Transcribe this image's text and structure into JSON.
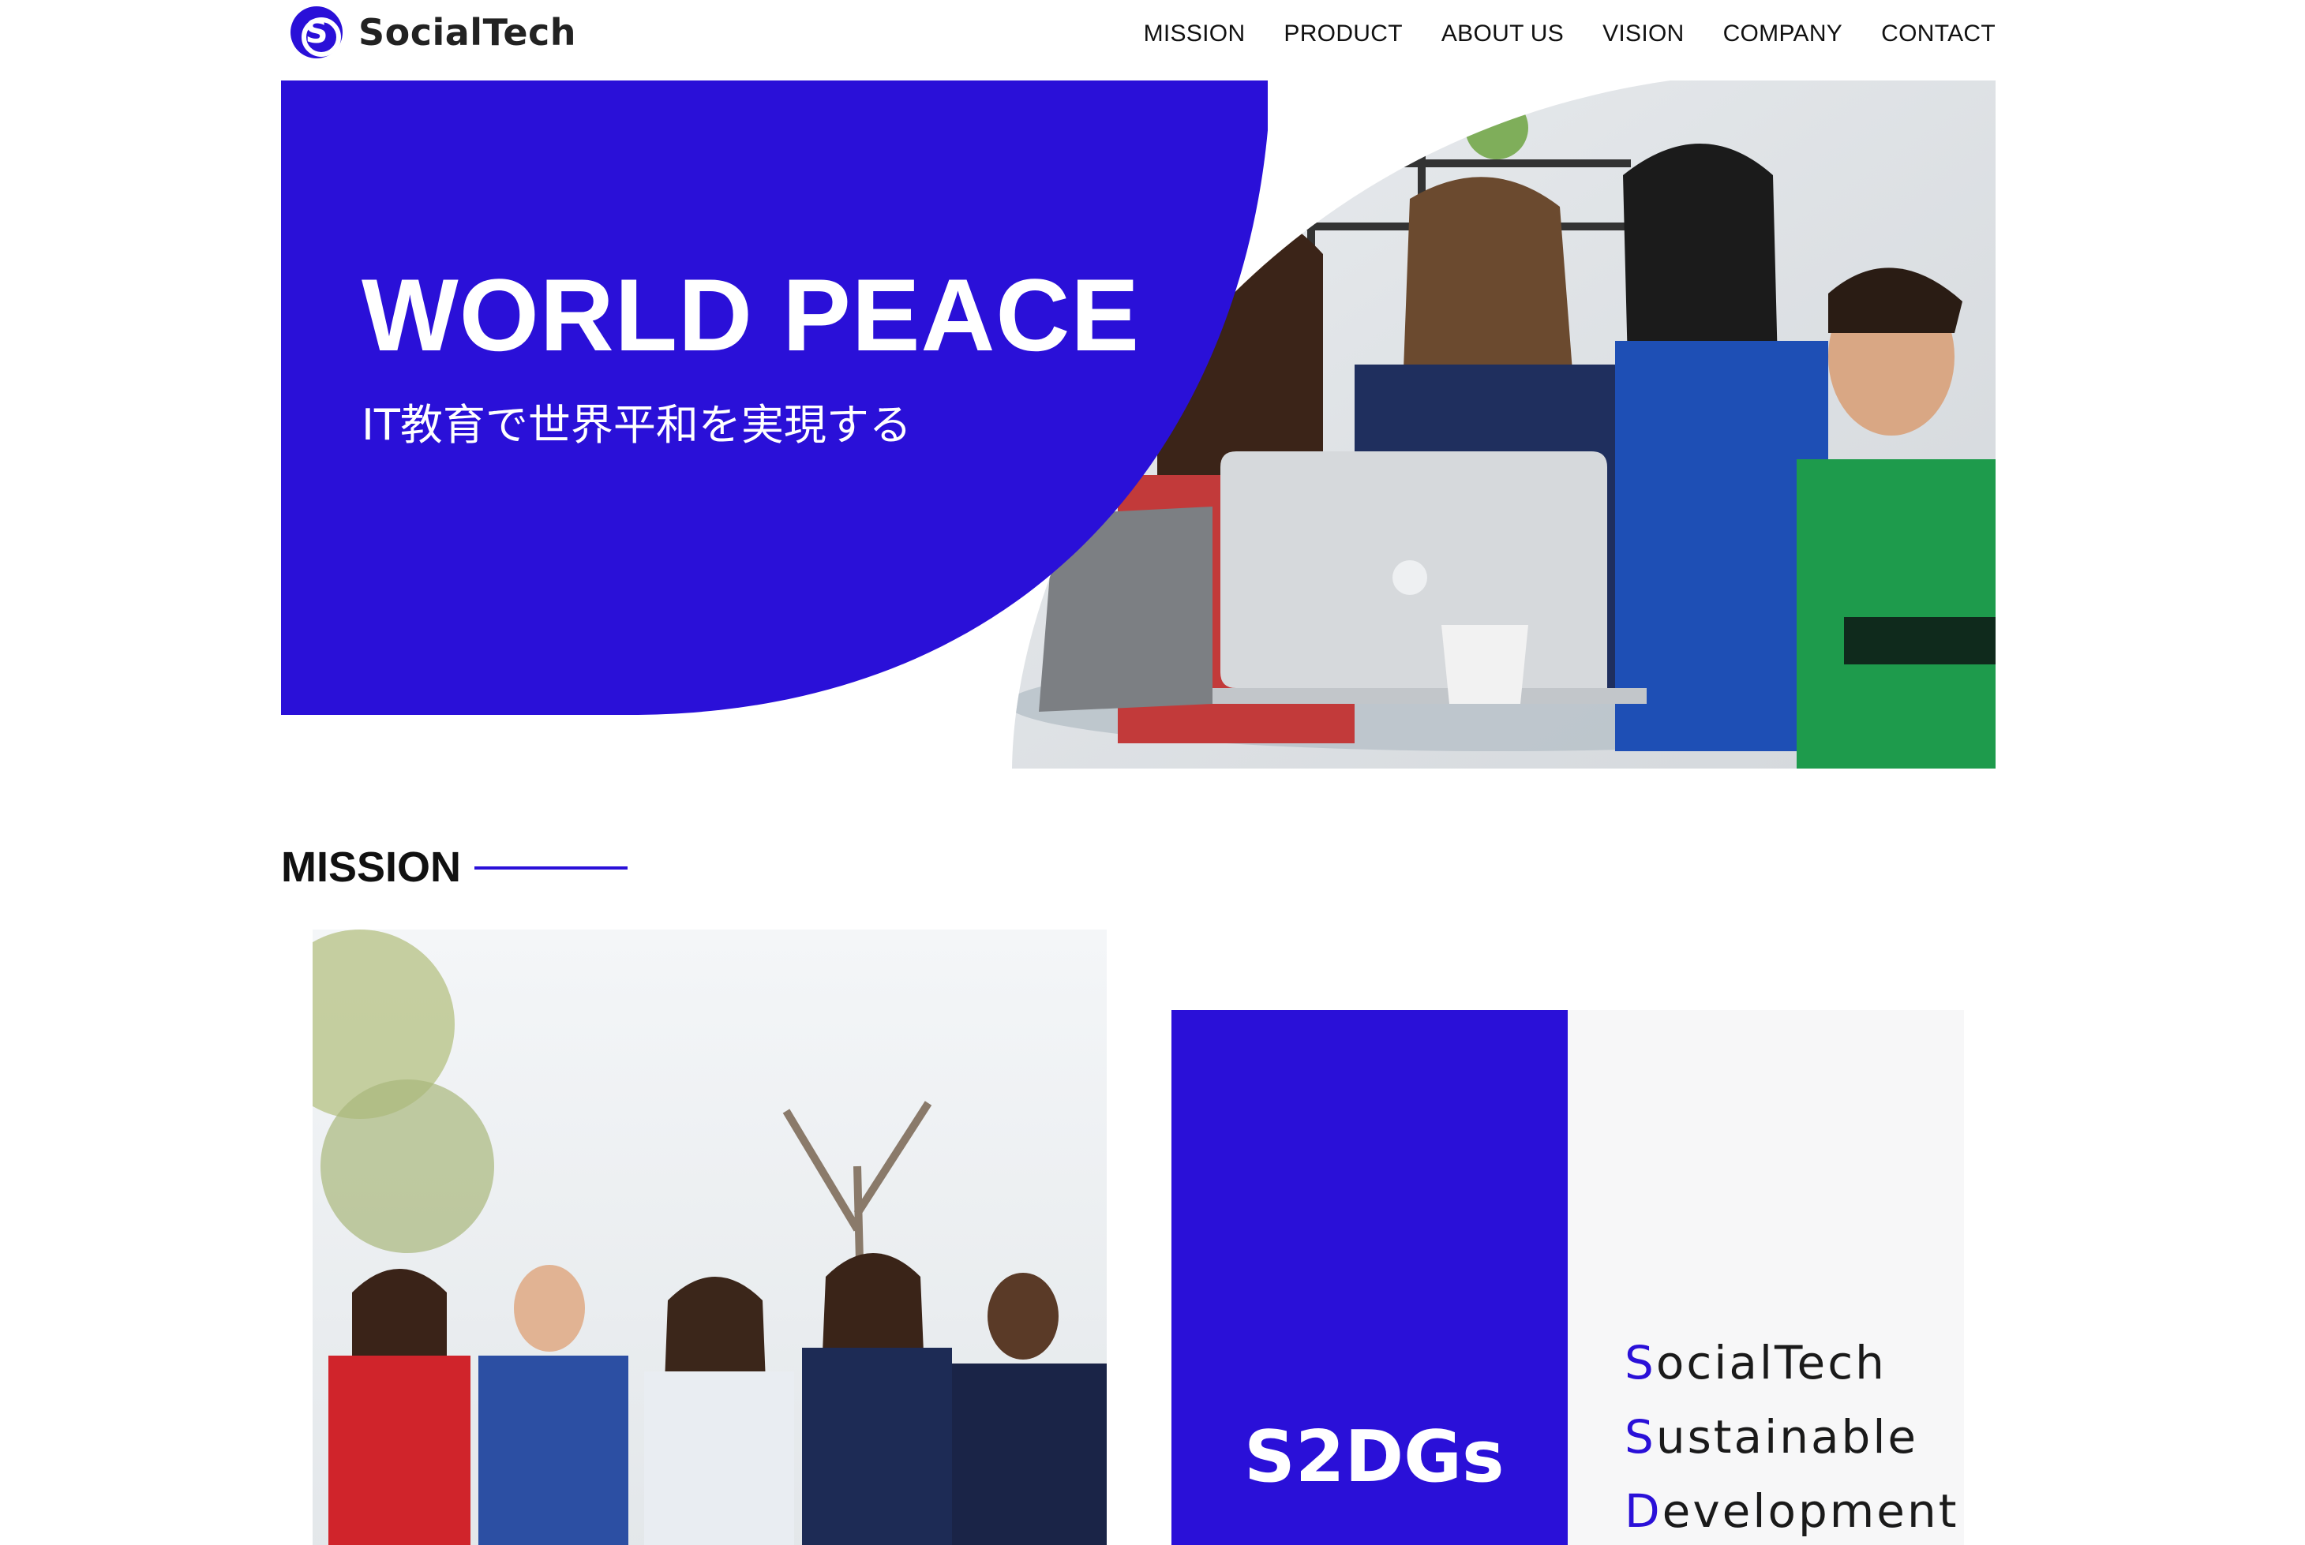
{
  "brand": {
    "name": "SocialTech",
    "logo_letter": "S"
  },
  "nav": {
    "items": [
      "MISSION",
      "PRODUCT",
      "ABOUT US",
      "VISION",
      "COMPANY",
      "CONTACT"
    ]
  },
  "hero": {
    "title": "WORLD PEACE",
    "subtitle": "IT教育で世界平和を実現する"
  },
  "mission": {
    "heading": "MISSION",
    "s2dgs": {
      "label": "S2DGs",
      "words": [
        {
          "initial": "S",
          "rest": "ocialTech"
        },
        {
          "initial": "S",
          "rest": "ustainable"
        },
        {
          "initial": "D",
          "rest": "evelopment"
        }
      ]
    }
  },
  "colors": {
    "accent": "#2a10d8",
    "panel": "#f7f7f8"
  }
}
